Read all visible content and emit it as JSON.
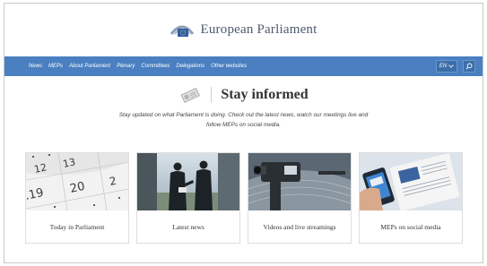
{
  "site": {
    "title": "European Parliament"
  },
  "nav": {
    "items": [
      "News",
      "MEPs",
      "About Parliament",
      "Plenary",
      "Committees",
      "Delegations",
      "Other websites"
    ],
    "language": "EN"
  },
  "section": {
    "title": "Stay informed",
    "intro_line1": "Stay updated on what Parliament is doing. Check out the latest news, watch our meetings live and",
    "intro_line2": "follow MEPs on social media."
  },
  "cards": [
    {
      "label": "Today in Parliament"
    },
    {
      "label": "Latest news"
    },
    {
      "label": "Videos and live streamings"
    },
    {
      "label": "MEPs on social media"
    }
  ],
  "colors": {
    "nav_bg": "#4a7fc1",
    "title_text": "#4b5b6e"
  },
  "icons": {
    "search": "search-icon",
    "language_chevron": "chevron-down-icon",
    "logo": "parliament-logo",
    "newspaper": "newspaper-icon"
  }
}
